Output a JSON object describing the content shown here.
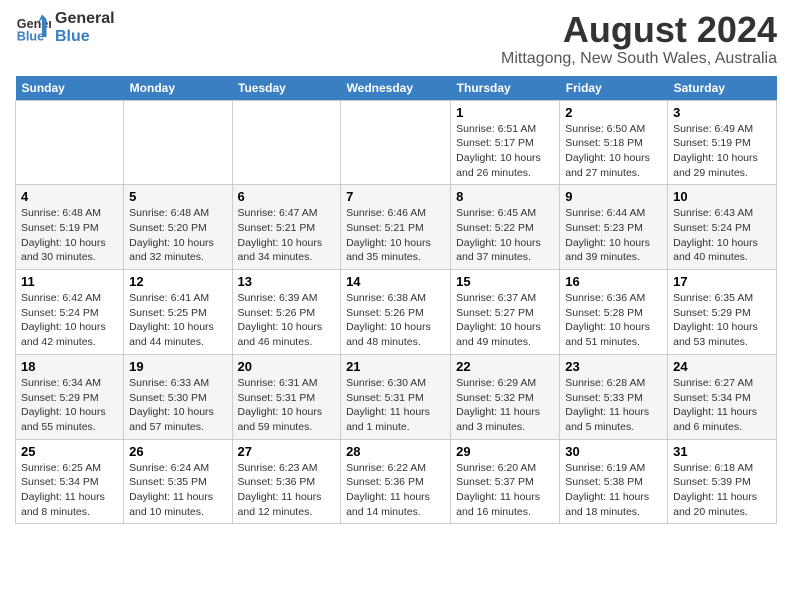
{
  "logo": {
    "line1": "General",
    "line2": "Blue"
  },
  "title": "August 2024",
  "subtitle": "Mittagong, New South Wales, Australia",
  "days_of_week": [
    "Sunday",
    "Monday",
    "Tuesday",
    "Wednesday",
    "Thursday",
    "Friday",
    "Saturday"
  ],
  "weeks": [
    [
      {
        "day": "",
        "info": ""
      },
      {
        "day": "",
        "info": ""
      },
      {
        "day": "",
        "info": ""
      },
      {
        "day": "",
        "info": ""
      },
      {
        "day": "1",
        "info": "Sunrise: 6:51 AM\nSunset: 5:17 PM\nDaylight: 10 hours\nand 26 minutes."
      },
      {
        "day": "2",
        "info": "Sunrise: 6:50 AM\nSunset: 5:18 PM\nDaylight: 10 hours\nand 27 minutes."
      },
      {
        "day": "3",
        "info": "Sunrise: 6:49 AM\nSunset: 5:19 PM\nDaylight: 10 hours\nand 29 minutes."
      }
    ],
    [
      {
        "day": "4",
        "info": "Sunrise: 6:48 AM\nSunset: 5:19 PM\nDaylight: 10 hours\nand 30 minutes."
      },
      {
        "day": "5",
        "info": "Sunrise: 6:48 AM\nSunset: 5:20 PM\nDaylight: 10 hours\nand 32 minutes."
      },
      {
        "day": "6",
        "info": "Sunrise: 6:47 AM\nSunset: 5:21 PM\nDaylight: 10 hours\nand 34 minutes."
      },
      {
        "day": "7",
        "info": "Sunrise: 6:46 AM\nSunset: 5:21 PM\nDaylight: 10 hours\nand 35 minutes."
      },
      {
        "day": "8",
        "info": "Sunrise: 6:45 AM\nSunset: 5:22 PM\nDaylight: 10 hours\nand 37 minutes."
      },
      {
        "day": "9",
        "info": "Sunrise: 6:44 AM\nSunset: 5:23 PM\nDaylight: 10 hours\nand 39 minutes."
      },
      {
        "day": "10",
        "info": "Sunrise: 6:43 AM\nSunset: 5:24 PM\nDaylight: 10 hours\nand 40 minutes."
      }
    ],
    [
      {
        "day": "11",
        "info": "Sunrise: 6:42 AM\nSunset: 5:24 PM\nDaylight: 10 hours\nand 42 minutes."
      },
      {
        "day": "12",
        "info": "Sunrise: 6:41 AM\nSunset: 5:25 PM\nDaylight: 10 hours\nand 44 minutes."
      },
      {
        "day": "13",
        "info": "Sunrise: 6:39 AM\nSunset: 5:26 PM\nDaylight: 10 hours\nand 46 minutes."
      },
      {
        "day": "14",
        "info": "Sunrise: 6:38 AM\nSunset: 5:26 PM\nDaylight: 10 hours\nand 48 minutes."
      },
      {
        "day": "15",
        "info": "Sunrise: 6:37 AM\nSunset: 5:27 PM\nDaylight: 10 hours\nand 49 minutes."
      },
      {
        "day": "16",
        "info": "Sunrise: 6:36 AM\nSunset: 5:28 PM\nDaylight: 10 hours\nand 51 minutes."
      },
      {
        "day": "17",
        "info": "Sunrise: 6:35 AM\nSunset: 5:29 PM\nDaylight: 10 hours\nand 53 minutes."
      }
    ],
    [
      {
        "day": "18",
        "info": "Sunrise: 6:34 AM\nSunset: 5:29 PM\nDaylight: 10 hours\nand 55 minutes."
      },
      {
        "day": "19",
        "info": "Sunrise: 6:33 AM\nSunset: 5:30 PM\nDaylight: 10 hours\nand 57 minutes."
      },
      {
        "day": "20",
        "info": "Sunrise: 6:31 AM\nSunset: 5:31 PM\nDaylight: 10 hours\nand 59 minutes."
      },
      {
        "day": "21",
        "info": "Sunrise: 6:30 AM\nSunset: 5:31 PM\nDaylight: 11 hours\nand 1 minute."
      },
      {
        "day": "22",
        "info": "Sunrise: 6:29 AM\nSunset: 5:32 PM\nDaylight: 11 hours\nand 3 minutes."
      },
      {
        "day": "23",
        "info": "Sunrise: 6:28 AM\nSunset: 5:33 PM\nDaylight: 11 hours\nand 5 minutes."
      },
      {
        "day": "24",
        "info": "Sunrise: 6:27 AM\nSunset: 5:34 PM\nDaylight: 11 hours\nand 6 minutes."
      }
    ],
    [
      {
        "day": "25",
        "info": "Sunrise: 6:25 AM\nSunset: 5:34 PM\nDaylight: 11 hours\nand 8 minutes."
      },
      {
        "day": "26",
        "info": "Sunrise: 6:24 AM\nSunset: 5:35 PM\nDaylight: 11 hours\nand 10 minutes."
      },
      {
        "day": "27",
        "info": "Sunrise: 6:23 AM\nSunset: 5:36 PM\nDaylight: 11 hours\nand 12 minutes."
      },
      {
        "day": "28",
        "info": "Sunrise: 6:22 AM\nSunset: 5:36 PM\nDaylight: 11 hours\nand 14 minutes."
      },
      {
        "day": "29",
        "info": "Sunrise: 6:20 AM\nSunset: 5:37 PM\nDaylight: 11 hours\nand 16 minutes."
      },
      {
        "day": "30",
        "info": "Sunrise: 6:19 AM\nSunset: 5:38 PM\nDaylight: 11 hours\nand 18 minutes."
      },
      {
        "day": "31",
        "info": "Sunrise: 6:18 AM\nSunset: 5:39 PM\nDaylight: 11 hours\nand 20 minutes."
      }
    ]
  ]
}
